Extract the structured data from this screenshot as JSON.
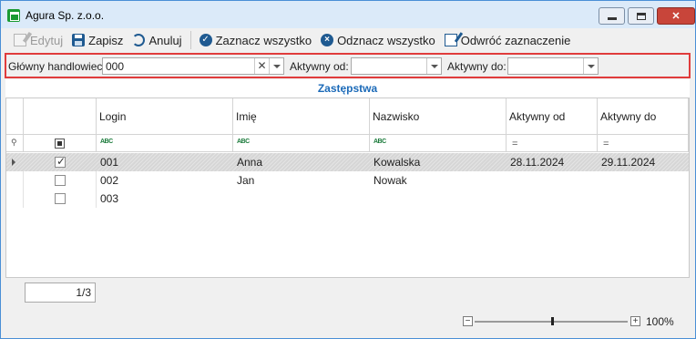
{
  "window": {
    "title": "Agura Sp. z.o.o.",
    "close_label": "✕"
  },
  "toolbar": {
    "edit_label": "Edytuj",
    "save_label": "Zapisz",
    "cancel_label": "Anuluj",
    "select_all_label": "Zaznacz wszystko",
    "deselect_all_label": "Odznacz wszystko",
    "invert_label": "Odwróć zaznaczenie"
  },
  "filters": {
    "salesman_label": "Główny handlowiec:",
    "salesman_value": "000",
    "active_from_label": "Aktywny od:",
    "active_from_value": "",
    "active_to_label": "Aktywny do:",
    "active_to_value": ""
  },
  "grid": {
    "title": "Zastępstwa",
    "columns": [
      "Login",
      "Imię",
      "Nazwisko",
      "Aktywny od",
      "Aktywny do"
    ],
    "filter_icons": [
      "abc-icon",
      "abc-icon",
      "abc-icon",
      "equals-icon",
      "equals-icon"
    ],
    "rows": [
      {
        "checked": true,
        "login": "001",
        "first_name": "Anna",
        "last_name": "Kowalska",
        "active_from": "28.11.2024",
        "active_to": "29.11.2024"
      },
      {
        "checked": false,
        "login": "002",
        "first_name": "Jan",
        "last_name": "Nowak",
        "active_from": "",
        "active_to": ""
      },
      {
        "checked": false,
        "login": "003",
        "first_name": "",
        "last_name": "",
        "active_from": "",
        "active_to": ""
      }
    ]
  },
  "pager": {
    "value": "1/3"
  },
  "zoom": {
    "minus": "−",
    "plus": "+",
    "level_label": "100%",
    "level": 100
  },
  "colors": {
    "accent": "#1b6ab8",
    "highlight_border": "#e03c3c"
  }
}
